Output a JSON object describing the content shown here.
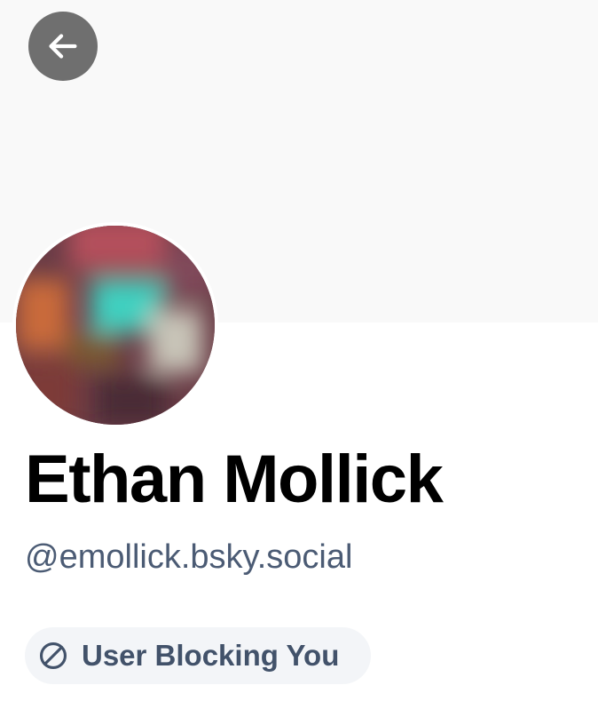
{
  "header": {
    "back_icon": "arrow-left-icon"
  },
  "profile": {
    "display_name": "Ethan Mollick",
    "handle": "@emollick.bsky.social",
    "block_status": {
      "icon": "ban-icon",
      "label": "User Blocking You"
    }
  },
  "colors": {
    "banner_background": "#f9f9f9",
    "back_button_background": "#6f6f6f",
    "handle_text": "#4b5b74",
    "badge_background": "#f3f5f8",
    "badge_text": "#42526a"
  }
}
